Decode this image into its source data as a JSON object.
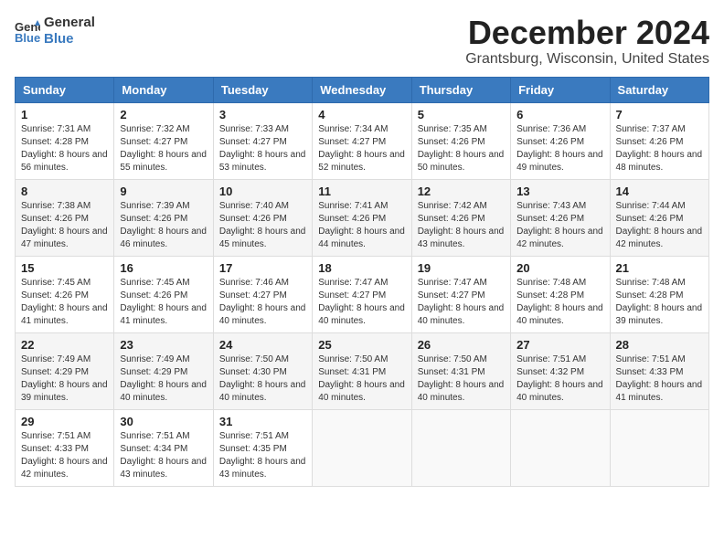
{
  "header": {
    "logo_line1": "General",
    "logo_line2": "Blue",
    "month_title": "December 2024",
    "location": "Grantsburg, Wisconsin, United States"
  },
  "weekdays": [
    "Sunday",
    "Monday",
    "Tuesday",
    "Wednesday",
    "Thursday",
    "Friday",
    "Saturday"
  ],
  "weeks": [
    [
      {
        "day": "1",
        "sunrise": "7:31 AM",
        "sunset": "4:28 PM",
        "daylight": "8 hours and 56 minutes."
      },
      {
        "day": "2",
        "sunrise": "7:32 AM",
        "sunset": "4:27 PM",
        "daylight": "8 hours and 55 minutes."
      },
      {
        "day": "3",
        "sunrise": "7:33 AM",
        "sunset": "4:27 PM",
        "daylight": "8 hours and 53 minutes."
      },
      {
        "day": "4",
        "sunrise": "7:34 AM",
        "sunset": "4:27 PM",
        "daylight": "8 hours and 52 minutes."
      },
      {
        "day": "5",
        "sunrise": "7:35 AM",
        "sunset": "4:26 PM",
        "daylight": "8 hours and 50 minutes."
      },
      {
        "day": "6",
        "sunrise": "7:36 AM",
        "sunset": "4:26 PM",
        "daylight": "8 hours and 49 minutes."
      },
      {
        "day": "7",
        "sunrise": "7:37 AM",
        "sunset": "4:26 PM",
        "daylight": "8 hours and 48 minutes."
      }
    ],
    [
      {
        "day": "8",
        "sunrise": "7:38 AM",
        "sunset": "4:26 PM",
        "daylight": "8 hours and 47 minutes."
      },
      {
        "day": "9",
        "sunrise": "7:39 AM",
        "sunset": "4:26 PM",
        "daylight": "8 hours and 46 minutes."
      },
      {
        "day": "10",
        "sunrise": "7:40 AM",
        "sunset": "4:26 PM",
        "daylight": "8 hours and 45 minutes."
      },
      {
        "day": "11",
        "sunrise": "7:41 AM",
        "sunset": "4:26 PM",
        "daylight": "8 hours and 44 minutes."
      },
      {
        "day": "12",
        "sunrise": "7:42 AM",
        "sunset": "4:26 PM",
        "daylight": "8 hours and 43 minutes."
      },
      {
        "day": "13",
        "sunrise": "7:43 AM",
        "sunset": "4:26 PM",
        "daylight": "8 hours and 42 minutes."
      },
      {
        "day": "14",
        "sunrise": "7:44 AM",
        "sunset": "4:26 PM",
        "daylight": "8 hours and 42 minutes."
      }
    ],
    [
      {
        "day": "15",
        "sunrise": "7:45 AM",
        "sunset": "4:26 PM",
        "daylight": "8 hours and 41 minutes."
      },
      {
        "day": "16",
        "sunrise": "7:45 AM",
        "sunset": "4:26 PM",
        "daylight": "8 hours and 41 minutes."
      },
      {
        "day": "17",
        "sunrise": "7:46 AM",
        "sunset": "4:27 PM",
        "daylight": "8 hours and 40 minutes."
      },
      {
        "day": "18",
        "sunrise": "7:47 AM",
        "sunset": "4:27 PM",
        "daylight": "8 hours and 40 minutes."
      },
      {
        "day": "19",
        "sunrise": "7:47 AM",
        "sunset": "4:27 PM",
        "daylight": "8 hours and 40 minutes."
      },
      {
        "day": "20",
        "sunrise": "7:48 AM",
        "sunset": "4:28 PM",
        "daylight": "8 hours and 40 minutes."
      },
      {
        "day": "21",
        "sunrise": "7:48 AM",
        "sunset": "4:28 PM",
        "daylight": "8 hours and 39 minutes."
      }
    ],
    [
      {
        "day": "22",
        "sunrise": "7:49 AM",
        "sunset": "4:29 PM",
        "daylight": "8 hours and 39 minutes."
      },
      {
        "day": "23",
        "sunrise": "7:49 AM",
        "sunset": "4:29 PM",
        "daylight": "8 hours and 40 minutes."
      },
      {
        "day": "24",
        "sunrise": "7:50 AM",
        "sunset": "4:30 PM",
        "daylight": "8 hours and 40 minutes."
      },
      {
        "day": "25",
        "sunrise": "7:50 AM",
        "sunset": "4:31 PM",
        "daylight": "8 hours and 40 minutes."
      },
      {
        "day": "26",
        "sunrise": "7:50 AM",
        "sunset": "4:31 PM",
        "daylight": "8 hours and 40 minutes."
      },
      {
        "day": "27",
        "sunrise": "7:51 AM",
        "sunset": "4:32 PM",
        "daylight": "8 hours and 40 minutes."
      },
      {
        "day": "28",
        "sunrise": "7:51 AM",
        "sunset": "4:33 PM",
        "daylight": "8 hours and 41 minutes."
      }
    ],
    [
      {
        "day": "29",
        "sunrise": "7:51 AM",
        "sunset": "4:33 PM",
        "daylight": "8 hours and 42 minutes."
      },
      {
        "day": "30",
        "sunrise": "7:51 AM",
        "sunset": "4:34 PM",
        "daylight": "8 hours and 43 minutes."
      },
      {
        "day": "31",
        "sunrise": "7:51 AM",
        "sunset": "4:35 PM",
        "daylight": "8 hours and 43 minutes."
      },
      null,
      null,
      null,
      null
    ]
  ],
  "labels": {
    "sunrise": "Sunrise: ",
    "sunset": "Sunset: ",
    "daylight": "Daylight: "
  }
}
